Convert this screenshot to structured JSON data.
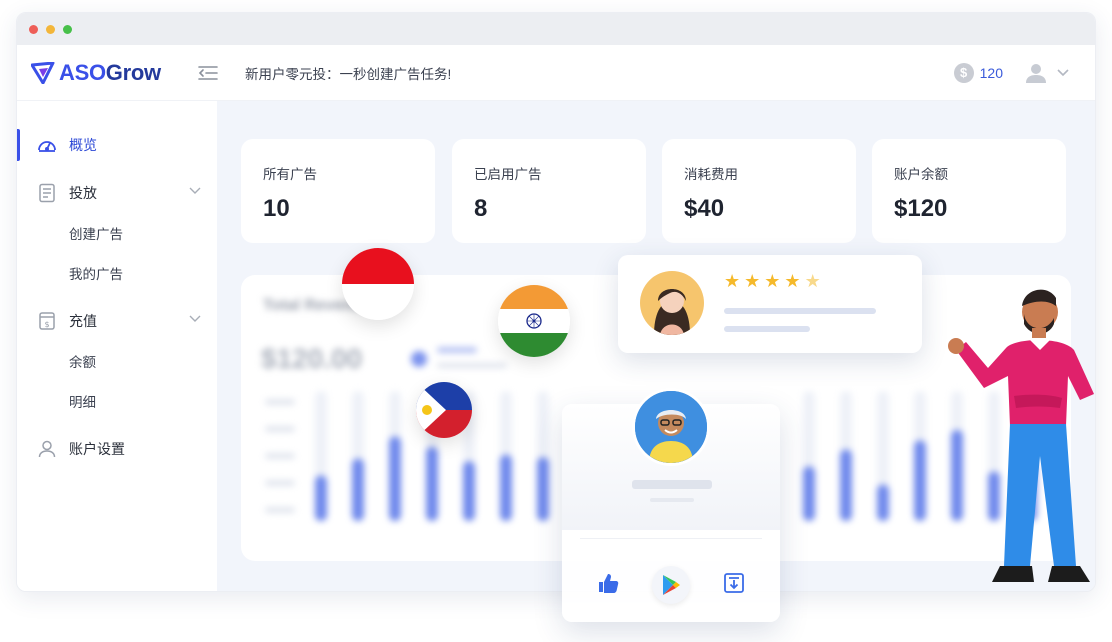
{
  "window": {
    "traffic_lights": [
      "#ee5e58",
      "#f3b63a",
      "#47c04a"
    ]
  },
  "header": {
    "logo_aso": "ASO",
    "logo_grow": "Grow",
    "promo_text": "新用户零元投：一秒创建广告任务!",
    "coin_symbol": "$",
    "coin_balance": "120"
  },
  "sidebar": {
    "items": [
      {
        "label": "概览",
        "icon": "dashboard-icon",
        "active": true
      },
      {
        "label": "投放",
        "icon": "document-icon",
        "children": [
          "创建广告",
          "我的广告"
        ]
      },
      {
        "label": "充值",
        "icon": "recharge-icon",
        "children": [
          "余额",
          "明细"
        ]
      },
      {
        "label": "账户设置",
        "icon": "user-icon"
      }
    ]
  },
  "stats": [
    {
      "label": "所有广告",
      "value": "10"
    },
    {
      "label": "已启用广告",
      "value": "8"
    },
    {
      "label": "消耗费用",
      "value": "$40"
    },
    {
      "label": "账户余额",
      "value": "$120"
    }
  ],
  "revenue": {
    "title": "Total Revenue",
    "amount": "$120.00"
  },
  "chart_data": {
    "type": "bar",
    "title": "Total Revenue",
    "bars_a": [
      0.35,
      0.48,
      0.65,
      0.57,
      0.46,
      0.51,
      0.49
    ],
    "bars_b": [
      0.42,
      0.55,
      0.28,
      0.62,
      0.7,
      0.38,
      0.45
    ],
    "ylim": [
      0,
      1
    ]
  },
  "review": {
    "rating": 4.5,
    "star_color": "#f5b92b"
  },
  "flags": [
    "indonesia-flag",
    "india-flag",
    "philippines-flag"
  ],
  "accent_color": "#3a50e8"
}
